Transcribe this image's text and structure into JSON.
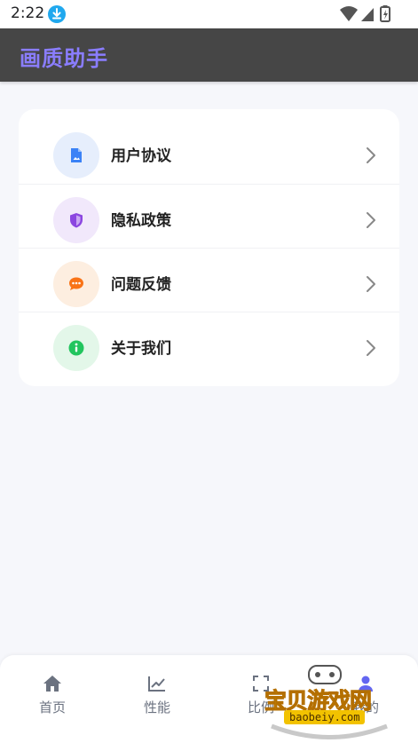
{
  "status_bar": {
    "time": "2:22"
  },
  "app_bar": {
    "title": "画质助手"
  },
  "menu": {
    "items": [
      {
        "label": "用户协议",
        "icon": "document-icon",
        "color": "#3b82f6",
        "bg": "#e6eefc"
      },
      {
        "label": "隐私政策",
        "icon": "shield-icon",
        "color": "#8b46e0",
        "bg": "#f1e8fb"
      },
      {
        "label": "问题反馈",
        "icon": "chat-bubble-icon",
        "color": "#f97316",
        "bg": "#fdeee0"
      },
      {
        "label": "关于我们",
        "icon": "info-icon",
        "color": "#22c55e",
        "bg": "#e3f7e9"
      }
    ]
  },
  "bottom_nav": {
    "items": [
      {
        "label": "首页",
        "icon": "home-icon"
      },
      {
        "label": "性能",
        "icon": "chart-line-icon"
      },
      {
        "label": "比例",
        "icon": "frame-corners-icon"
      },
      {
        "label": "我的",
        "icon": "person-icon",
        "active": true
      }
    ]
  },
  "watermark": {
    "text": "宝贝游戏网",
    "url": "baobeiy.com"
  },
  "colors": {
    "title_purple": "#8a7dff",
    "app_bar_bg": "#464646",
    "page_bg": "#f6f7fb"
  }
}
